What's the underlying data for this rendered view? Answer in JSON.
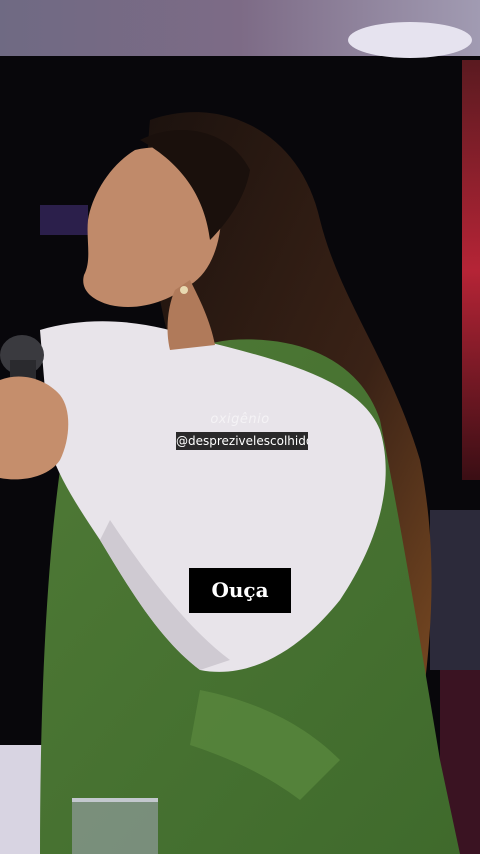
{
  "video": {
    "watermark_brand": "oxigênio",
    "watermark_handle": "@desprezivelescolhido",
    "caption": "Ouça"
  }
}
